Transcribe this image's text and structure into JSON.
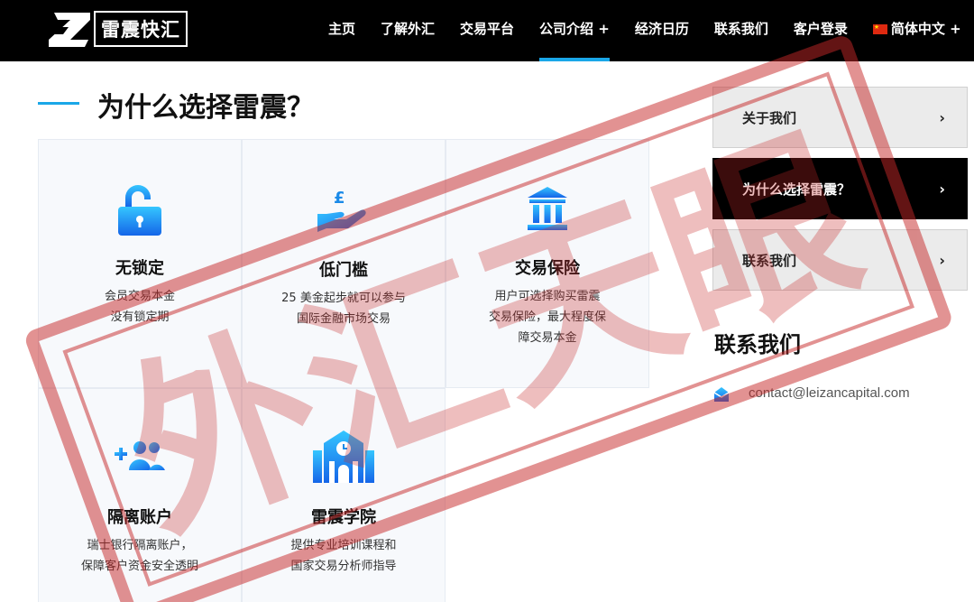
{
  "header": {
    "logo_text": "雷震快汇",
    "nav": [
      {
        "label": "主页"
      },
      {
        "label": "了解外汇"
      },
      {
        "label": "交易平台"
      },
      {
        "label": "公司介绍 +"
      },
      {
        "label": "经济日历"
      },
      {
        "label": "联系我们"
      },
      {
        "label": "客户登录"
      },
      {
        "label": "简体中文 +"
      }
    ],
    "active_nav": "公司介绍 +",
    "accent_color": "#1aa7e8"
  },
  "main": {
    "title": "为什么选择雷震？",
    "features": [
      {
        "icon": "unlock-icon",
        "title": "无锁定",
        "desc": [
          "会员交易本金",
          "没有锁定期"
        ]
      },
      {
        "icon": "hand-pound-icon",
        "title": "低门槛",
        "desc": [
          "25 美金起步就可以参与",
          "国际金融市场交易"
        ]
      },
      {
        "icon": "bank-icon",
        "title": "交易保险",
        "desc": [
          "用户可选择购买雷震",
          "交易保险，最大程度保",
          "障交易本金"
        ]
      },
      {
        "icon": "add-users-icon",
        "title": "隔离账户",
        "desc": [
          "瑞士银行隔离账户，",
          "保障客户资金安全透明"
        ]
      },
      {
        "icon": "academy-icon",
        "title": "雷震学院",
        "desc": [
          "提供专业培训课程和",
          "国家交易分析师指导"
        ]
      }
    ]
  },
  "sidebar": {
    "items": [
      {
        "label": "关于我们",
        "active": false
      },
      {
        "label": "为什么选择雷震？",
        "active": true
      },
      {
        "label": "联系我们",
        "active": false
      }
    ],
    "arrow": "›",
    "contact_heading": "联系我们",
    "email": "contact@leizancapital.com"
  },
  "watermark": {
    "text": "外汇天眼",
    "color": "#c62828"
  }
}
